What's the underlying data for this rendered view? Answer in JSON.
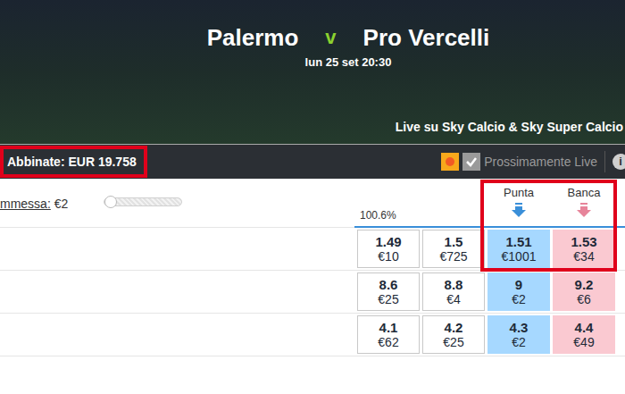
{
  "match": {
    "home": "Palermo",
    "separator": "v",
    "away": "Pro Vercelli",
    "datetime": "lun 25 set 20:30",
    "broadcast": "Live su Sky Calcio & Sky Super Calcio"
  },
  "toolbar": {
    "matched": {
      "label": "Abbinate: EUR 19.758",
      "highlighted": true
    },
    "live_checkbox": {
      "checked": true,
      "label": "Prossimamente Live"
    },
    "info": "i"
  },
  "stake": {
    "label": "mmessa:",
    "value": "€2",
    "level": 0
  },
  "market": {
    "book": "100.6%",
    "columns": [
      {
        "label": "Punta",
        "kind": "back",
        "highlighted": true
      },
      {
        "label": "Banca",
        "kind": "lay",
        "highlighted": true
      }
    ],
    "rows": [
      {
        "highlighted": true,
        "prices": [
          {
            "odds": "1.49",
            "amount": "€10",
            "kind": "back",
            "best": false
          },
          {
            "odds": "1.5",
            "amount": "€725",
            "kind": "back",
            "best": false
          },
          {
            "odds": "1.51",
            "amount": "€1001",
            "kind": "back",
            "best": true
          },
          {
            "odds": "1.53",
            "amount": "€34",
            "kind": "lay",
            "best": true
          }
        ]
      },
      {
        "highlighted": false,
        "prices": [
          {
            "odds": "8.6",
            "amount": "€25",
            "kind": "back",
            "best": false
          },
          {
            "odds": "8.8",
            "amount": "€4",
            "kind": "back",
            "best": false
          },
          {
            "odds": "9",
            "amount": "€2",
            "kind": "back",
            "best": true
          },
          {
            "odds": "9.2",
            "amount": "€6",
            "kind": "lay",
            "best": true
          }
        ]
      },
      {
        "highlighted": false,
        "prices": [
          {
            "odds": "4.1",
            "amount": "€62",
            "kind": "back",
            "best": false
          },
          {
            "odds": "4.2",
            "amount": "€25",
            "kind": "back",
            "best": false
          },
          {
            "odds": "4.3",
            "amount": "€2",
            "kind": "back",
            "best": true
          },
          {
            "odds": "4.4",
            "amount": "€49",
            "kind": "lay",
            "best": true
          }
        ]
      }
    ]
  }
}
